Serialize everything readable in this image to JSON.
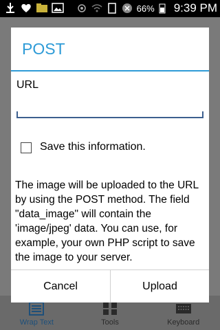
{
  "status_bar": {
    "battery": "66%",
    "time": "9:39 PM"
  },
  "background": {
    "tabs": [
      {
        "label": "Wrap Text",
        "icon": "wrap-text-icon"
      },
      {
        "label": "Tools",
        "icon": "grid-icon"
      },
      {
        "label": "Keyboard",
        "icon": "keyboard-icon"
      }
    ]
  },
  "dialog": {
    "title": "POST",
    "url_label": "URL",
    "url_value": "",
    "save_label": "Save this information.",
    "description": "The image will be uploaded to the URL by using the POST method. The field \"data_image\" will contain the 'image/jpeg' data. You can use, for example, your own PHP script to save the image to your server.",
    "cancel_label": "Cancel",
    "upload_label": "Upload"
  },
  "colors": {
    "accent": "#2e9bd7",
    "input_underline": "#3d5f8e"
  }
}
